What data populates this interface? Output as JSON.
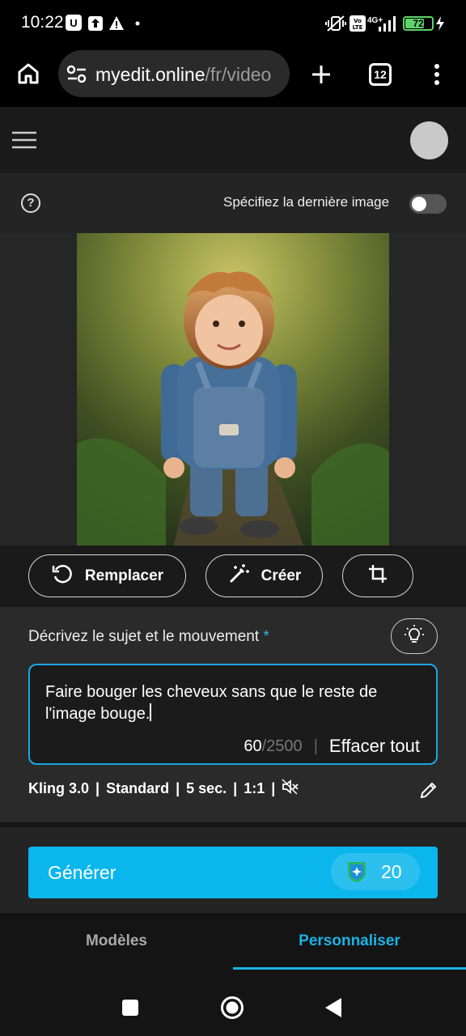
{
  "status_bar": {
    "time": "10:22",
    "network": "4G+",
    "volte": "Vo LTE",
    "battery": "72",
    "battery_level": 0.72
  },
  "browser": {
    "url_domain": "myedit.online",
    "url_path": "/fr/video",
    "tab_count": "12"
  },
  "settings": {
    "last_image_label": "Spécifiez la dernière image",
    "last_image_enabled": false
  },
  "actions": {
    "replace_label": "Remplacer",
    "create_label": "Créer"
  },
  "prompt": {
    "label": "Décrivez le sujet et le mouvement",
    "required_mark": "*",
    "text": "Faire bouger les cheveux sans que le reste de l'image bouge.",
    "char_count": "60",
    "char_max": "/2500",
    "separator": "|",
    "clear_label": "Effacer tout"
  },
  "video_settings": {
    "model": "Kling 3.0",
    "quality": "Standard",
    "duration": "5 sec.",
    "ratio": "1:1",
    "separator": "|"
  },
  "generate": {
    "label": "Générer",
    "credits": "20"
  },
  "tabs": {
    "models": "Modèles",
    "customize": "Personnaliser",
    "active": "customize"
  },
  "colors": {
    "accent": "#0bb6ec",
    "tab_active": "#1ab3e6",
    "battery": "#5fd36a"
  }
}
